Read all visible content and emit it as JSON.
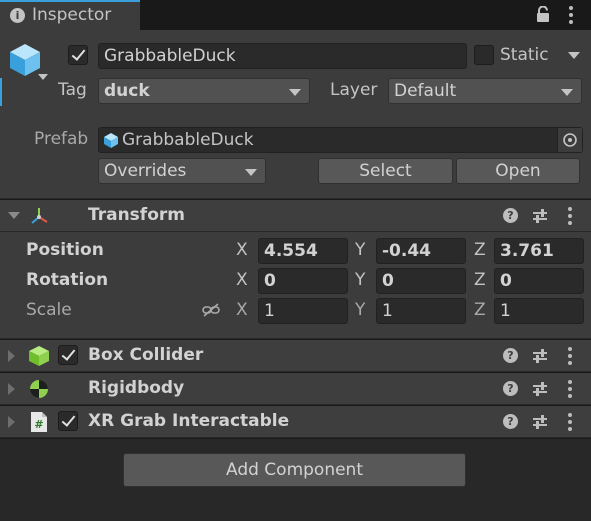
{
  "tab": {
    "title": "Inspector"
  },
  "object": {
    "active": true,
    "name": "GrabbableDuck",
    "static_label": "Static",
    "static_checked": false,
    "tag_label": "Tag",
    "tag_value": "duck",
    "layer_label": "Layer",
    "layer_value": "Default"
  },
  "prefab": {
    "label": "Prefab",
    "value": "GrabbableDuck",
    "overrides": "Overrides",
    "select": "Select",
    "open": "Open"
  },
  "transform": {
    "title": "Transform",
    "position": {
      "label": "Position",
      "x": "4.554",
      "y": "-0.44",
      "z": "3.761"
    },
    "rotation": {
      "label": "Rotation",
      "x": "0",
      "y": "0",
      "z": "0"
    },
    "scale": {
      "label": "Scale",
      "x": "1",
      "y": "1",
      "z": "1"
    },
    "axes": {
      "x": "X",
      "y": "Y",
      "z": "Z"
    }
  },
  "components": [
    {
      "title": "Box Collider",
      "enabled": true,
      "icon": "box-collider-icon"
    },
    {
      "title": "Rigidbody",
      "icon": "rigidbody-icon"
    },
    {
      "title": "XR Grab Interactable",
      "enabled": true,
      "icon": "script-icon"
    }
  ],
  "add_component": "Add Component",
  "colors": {
    "background": "#282828",
    "header": "#3e3e3e",
    "field": "#2a2a2a",
    "button": "#585858",
    "accent_blue": "#3aa0dc",
    "box_green": "#8fd14f"
  }
}
